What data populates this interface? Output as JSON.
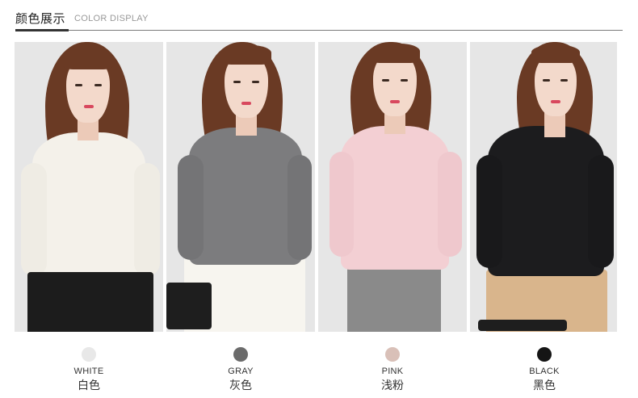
{
  "header": {
    "title_cn": "颜色展示",
    "title_en": "COLOR DISPLAY"
  },
  "products": [
    {
      "name_en": "WHITE",
      "name_cn": "白色",
      "color": "#e8e8e8",
      "sweater": "#f4f1ea",
      "skirt": "#1c1c1c"
    },
    {
      "name_en": "GRAY",
      "name_cn": "灰色",
      "color": "#6b6b6b",
      "sweater": "#7c7c7e",
      "skirt": "#f7f5ef"
    },
    {
      "name_en": "PINK",
      "name_cn": "浅粉",
      "color": "#d9c0b8",
      "sweater": "#f3cfd3",
      "skirt": "#8a8a8a"
    },
    {
      "name_en": "BLACK",
      "name_cn": "黑色",
      "color": "#151515",
      "sweater": "#1c1c1e",
      "skirt": "#d9b58c"
    }
  ]
}
